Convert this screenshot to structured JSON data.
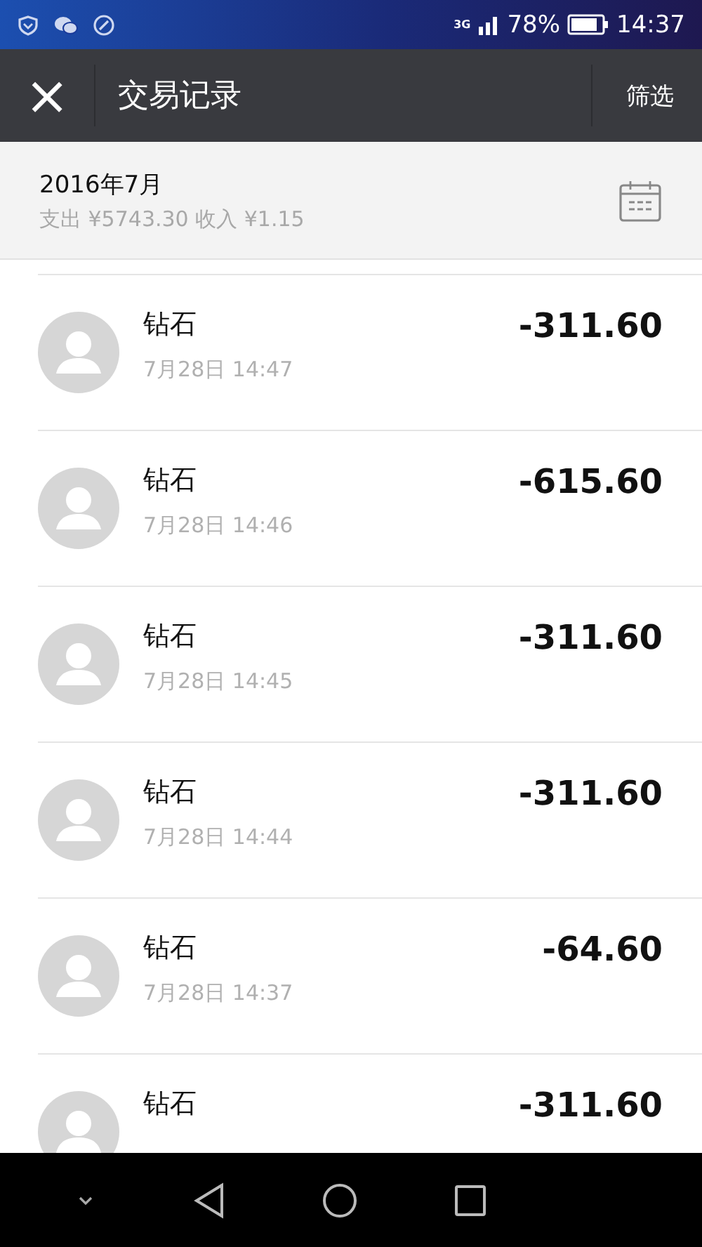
{
  "status_bar": {
    "network": "3G",
    "battery_percent": "78%",
    "time": "14:37"
  },
  "header": {
    "close": "×",
    "title": "交易记录",
    "filter": "筛选"
  },
  "summary": {
    "month": "2016年7月",
    "totals": "支出 ¥5743.30 收入 ¥1.15"
  },
  "transactions": [
    {
      "name": "钻石",
      "time": "7月28日 14:47",
      "amount": "-311.60"
    },
    {
      "name": "钻石",
      "time": "7月28日 14:46",
      "amount": "-615.60"
    },
    {
      "name": "钻石",
      "time": "7月28日 14:45",
      "amount": "-311.60"
    },
    {
      "name": "钻石",
      "time": "7月28日 14:44",
      "amount": "-311.60"
    },
    {
      "name": "钻石",
      "time": "7月28日 14:37",
      "amount": "-64.60"
    },
    {
      "name": "钻石",
      "amount": "-311.60"
    }
  ]
}
